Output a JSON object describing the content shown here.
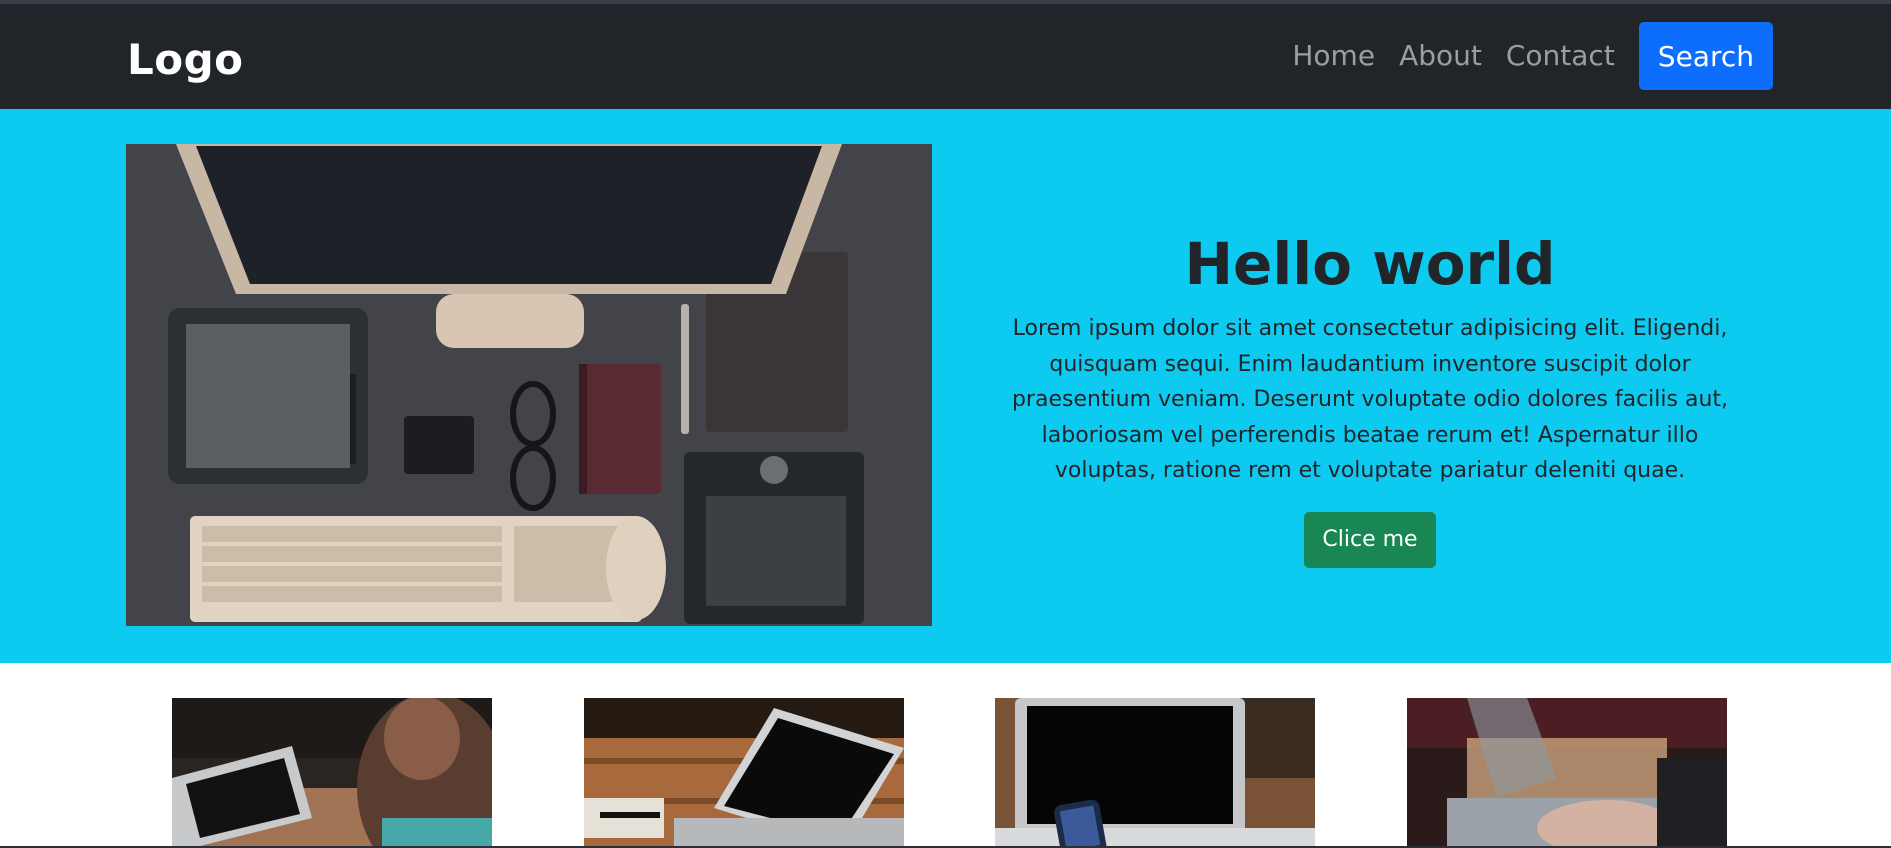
{
  "navbar": {
    "logo": "Logo",
    "links": [
      "Home",
      "About",
      "Contact"
    ],
    "search_label": "Search"
  },
  "hero": {
    "title": "Hello world",
    "body": "Lorem ipsum dolor sit amet consectetur adipisicing elit. Eligendi, quisquam sequi. Enim laudantium inventore suscipit dolor praesentium veniam. Deserunt voluptate odio dolores facilis aut, laboriosam vel perferendis beatae rerum et! Aspernatur illo voluptas, ratione rem et voluptate pariatur deleniti quae.",
    "button_label": "Clice me",
    "image": "desk-workspace-photo"
  },
  "cards": [
    {
      "image": "person-laptop-photo"
    },
    {
      "image": "laptop-desk-photo"
    },
    {
      "image": "laptop-phone-photo"
    },
    {
      "image": "typing-laptop-photo"
    }
  ],
  "colors": {
    "navbar_bg": "#212529",
    "hero_bg": "#0dcaf0",
    "search_button": "#0d6efd",
    "click_button": "#198754"
  }
}
